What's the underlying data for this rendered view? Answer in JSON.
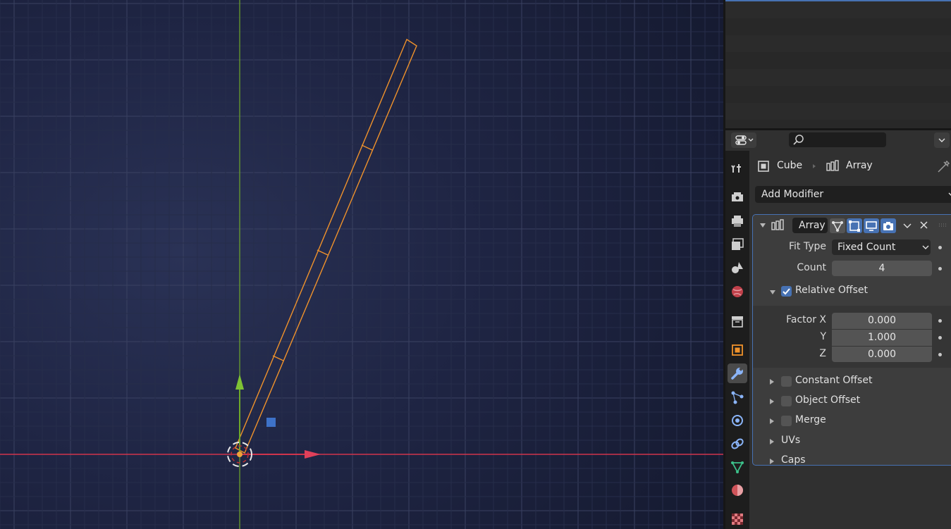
{
  "properties": {
    "breadcrumb": {
      "object": "Cube",
      "modifier": "Array"
    },
    "add_modifier_label": "Add Modifier",
    "modifier": {
      "name": "Array",
      "fit_type_label": "Fit Type",
      "fit_type_value": "Fixed Count",
      "count_label": "Count",
      "count_value": "4",
      "relative_offset": {
        "label": "Relative Offset",
        "checked": true,
        "factor_x_label": "Factor X",
        "factor_x": "0.000",
        "y_label": "Y",
        "y": "1.000",
        "z_label": "Z",
        "z": "0.000"
      },
      "subpanels": [
        {
          "label": "Constant Offset",
          "checkbox": true,
          "checked": false
        },
        {
          "label": "Object Offset",
          "checkbox": true,
          "checked": false
        },
        {
          "label": "Merge",
          "checkbox": true,
          "checked": false
        },
        {
          "label": "UVs",
          "checkbox": false
        },
        {
          "label": "Caps",
          "checkbox": false
        }
      ]
    }
  },
  "colors": {
    "accent": "#4772b3",
    "selection_outline": "#f0922b",
    "x_axis": "#d0344c",
    "y_axis": "#6ea82a",
    "modifier_tab_icon": "#8ab4f8"
  },
  "icons": {
    "tabs": [
      "tool-icon",
      "render-icon",
      "output-icon",
      "view-layer-icon",
      "scene-icon",
      "world-icon",
      "collection-icon",
      "object-icon",
      "modifier-wrench-icon",
      "particles-icon",
      "physics-icon",
      "constraints-icon",
      "object-data-icon",
      "material-icon",
      "texture-icon"
    ]
  }
}
